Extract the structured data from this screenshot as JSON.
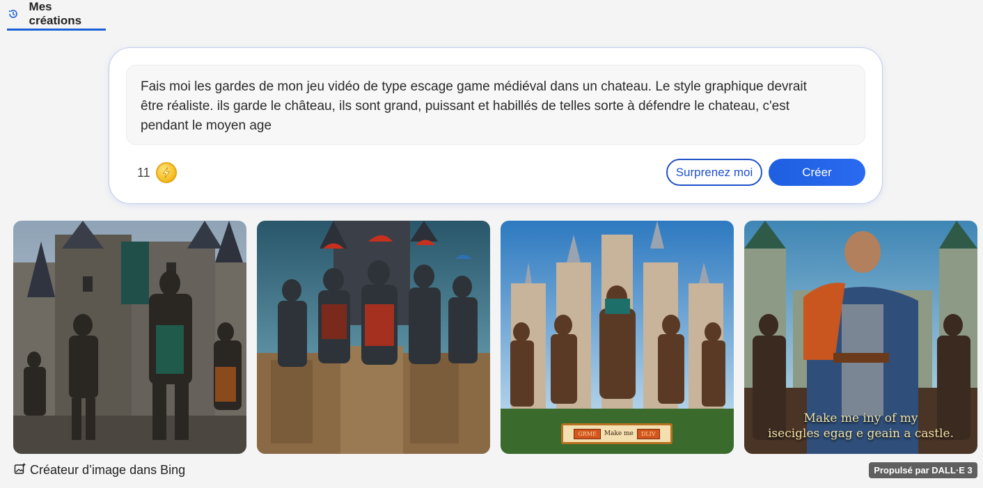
{
  "tab": {
    "label": "Mes créations",
    "icon": "history-icon"
  },
  "prompt": {
    "text": "Fais moi les gardes de mon jeu vidéo de type escage game médiéval dans un chateau. Le style graphique devrait être réaliste. ils garde le château, ils sont grand, puissant et habillés de telles sorte à défendre le chateau, c'est pendant le moyen age"
  },
  "credits": {
    "count": "11",
    "icon": "lightning-coin-icon"
  },
  "buttons": {
    "surprise": "Surprenez moi",
    "create": "Créer"
  },
  "images": [
    {
      "alt": "medieval castle guards 1"
    },
    {
      "alt": "medieval castle guards 2"
    },
    {
      "alt": "medieval castle guards 3",
      "plate": [
        "GRME",
        "Make me",
        "DLIV"
      ]
    },
    {
      "alt": "medieval castle guards 4",
      "caption_line1": "Make me iny of my",
      "caption_line2": "isecigles egag e geain  a  castle."
    }
  ],
  "footer": {
    "creator_label": "Créateur d’image dans Bing",
    "creator_icon": "image-sparkle-icon",
    "powered_by": "Propulsé par DALL·E 3"
  },
  "colors": {
    "accent": "#1f4fc9",
    "create_bg": "#2563eb",
    "badge_bg": "#5f5f5f"
  }
}
